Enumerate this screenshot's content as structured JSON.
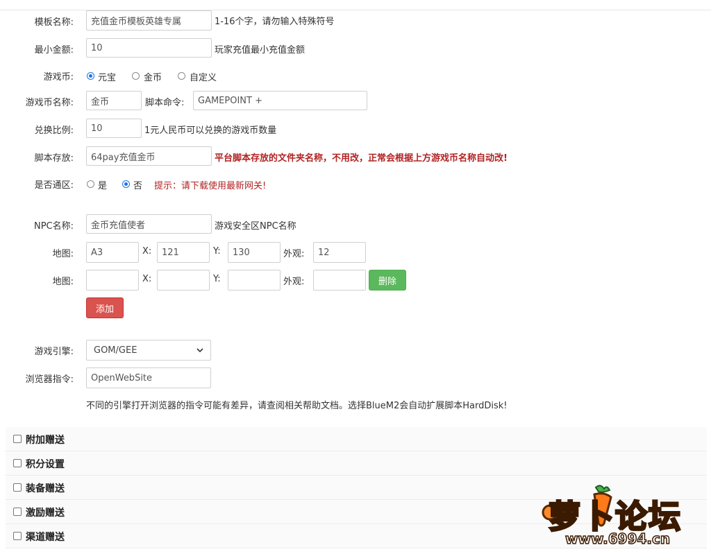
{
  "template_name": {
    "label": "模板名称:",
    "value": "充值金币模板英雄专属",
    "hint": "1-16个字，请勿输入特殊符号"
  },
  "min_amount": {
    "label": "最小金额:",
    "value": "10",
    "hint": "玩家充值最小充值金额"
  },
  "game_currency": {
    "label": "游戏币:",
    "options": [
      "元宝",
      "金币",
      "自定义"
    ],
    "selected": "元宝"
  },
  "currency_name": {
    "label": "游戏币名称:",
    "value": "金币",
    "script_label": "脚本命令:",
    "script_value": "GAMEPOINT +"
  },
  "ratio": {
    "label": "兑换比例:",
    "value": "10",
    "hint": "1元人民币可以兑换的游戏币数量"
  },
  "script_store": {
    "label": "脚本存放:",
    "value": "64pay充值金币",
    "hint": "平台脚本存放的文件夹名称，不用改，正常会根据上方游戏币名称自动改!"
  },
  "cross_zone": {
    "label": "是否通区:",
    "options": [
      "是",
      "否"
    ],
    "selected": "否",
    "tip": "提示：请下载使用最新网关!"
  },
  "npc_name": {
    "label": "NPC名称:",
    "value": "金币充值使者",
    "hint": "游戏安全区NPC名称"
  },
  "maps": [
    {
      "label": "地图:",
      "map": "A3",
      "x_label": "X:",
      "x": "121",
      "y_label": "Y:",
      "y": "130",
      "look_label": "外观:",
      "look": "12"
    },
    {
      "label": "地图:",
      "map": "",
      "x_label": "X:",
      "x": "",
      "y_label": "Y:",
      "y": "",
      "look_label": "外观:",
      "look": "",
      "delete_label": "删除"
    }
  ],
  "add_label": "添加",
  "engine": {
    "label": "游戏引擎:",
    "value": "GOM/GEE"
  },
  "browser_cmd": {
    "label": "浏览器指令:",
    "value": "OpenWebSite",
    "note": "不同的引擎打开浏览器的指令可能有差异，请查阅相关帮助文档。选择BlueM2会自动扩展脚本HardDisk!"
  },
  "sections": [
    "附加赠送",
    "积分设置",
    "装备赠送",
    "激励赠送",
    "渠道赠送"
  ],
  "watermark": {
    "title": "萝卜论坛",
    "url": "www.6994.cn"
  },
  "colors": {
    "accent": "#1a73e8",
    "green": "#5cb85c",
    "red": "#d9534f",
    "warn": "#b22222"
  }
}
